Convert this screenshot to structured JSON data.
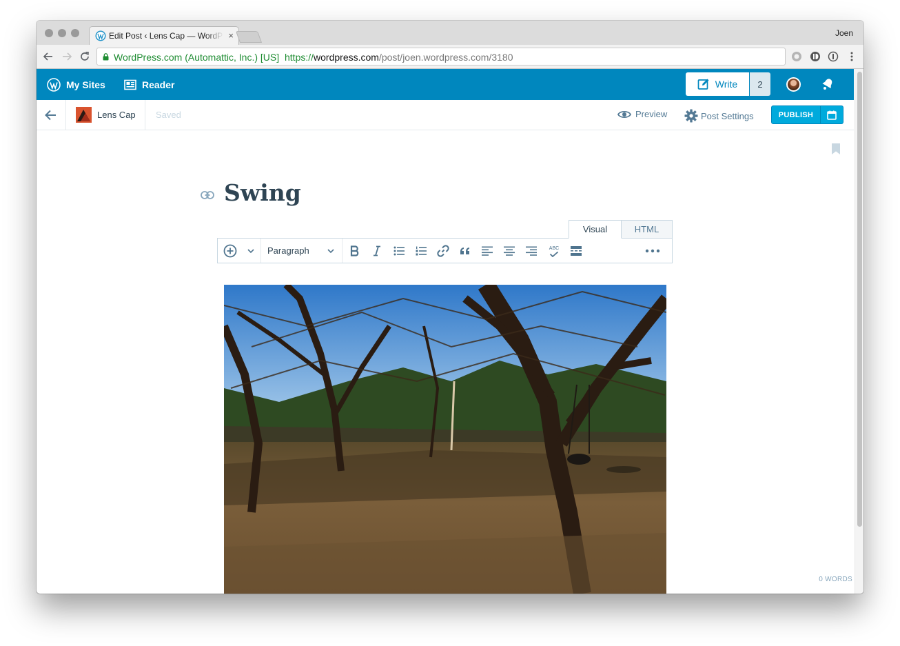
{
  "browser": {
    "tab_title": "Edit Post ‹ Lens Cap — WordPress.com",
    "tab_close": "×",
    "profile_name": "Joen",
    "cert_label": "WordPress.com (Automattic, Inc.) [US]",
    "url_protocol": "https://",
    "url_host": "wordpress.com",
    "url_path": "/post/joen.wordpress.com/3180"
  },
  "masterbar": {
    "my_sites_label": "My Sites",
    "reader_label": "Reader",
    "write_label": "Write",
    "drafts_count": "2"
  },
  "editor_bar": {
    "site_name": "Lens Cap",
    "save_status": "Saved",
    "preview_label": "Preview",
    "post_settings_label": "Post Settings",
    "publish_label": "PUBLISH"
  },
  "post": {
    "title": "Swing",
    "word_count": "0 WORDS"
  },
  "editor_tabs": {
    "visual_label": "Visual",
    "html_label": "HTML"
  },
  "toolbar": {
    "format_select": "Paragraph",
    "spellcheck_glyph": "ABC",
    "icons": [
      "add-icon",
      "chevron-down-icon",
      "bold-icon",
      "italic-icon",
      "bullet-list-icon",
      "numbered-list-icon",
      "link-icon",
      "blockquote-icon",
      "align-left-icon",
      "align-center-icon",
      "align-right-icon",
      "spellcheck-icon",
      "read-more-icon",
      "more-icon"
    ]
  },
  "colors": {
    "masterbar": "#0087be",
    "accent": "#00aadc",
    "text": "#2e4453",
    "muted": "#537994",
    "green_secure": "#1e8c32"
  }
}
